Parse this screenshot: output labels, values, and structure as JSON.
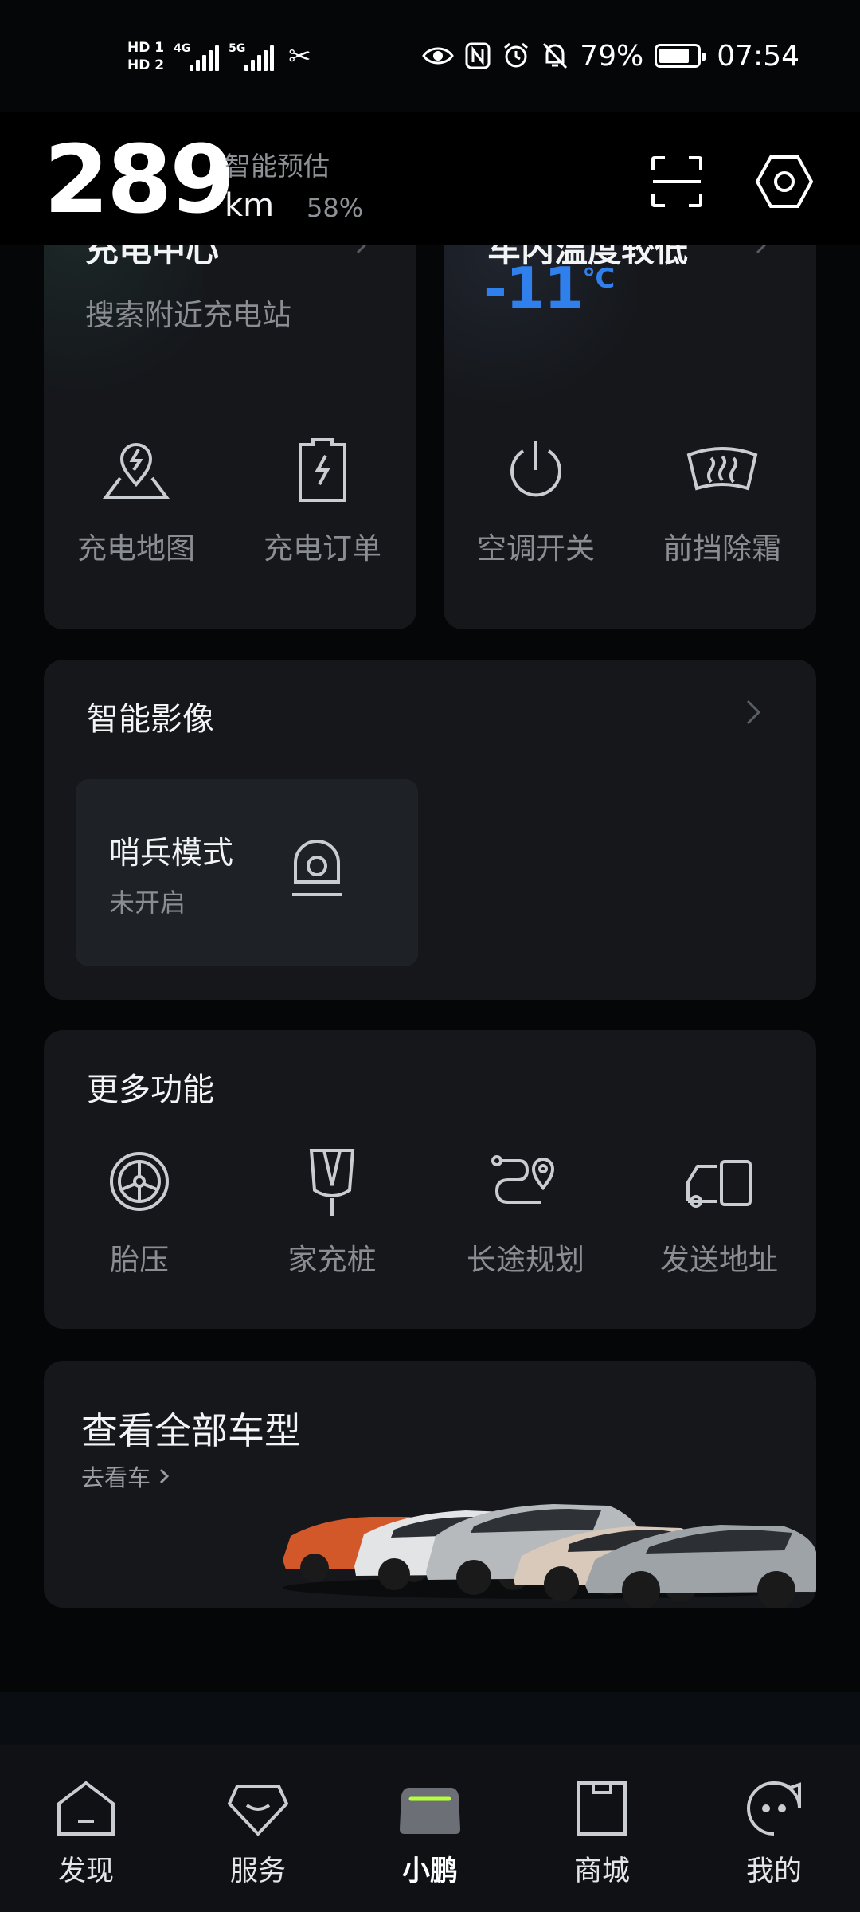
{
  "status_bar": {
    "sim1": "HD 1",
    "sim2": "HD 2",
    "net1": "4G",
    "net2": "5G",
    "battery_pct": "79%",
    "battery_level": 0.79,
    "time": "07:54",
    "icons": [
      "eye-icon",
      "nfc-icon",
      "alarm-icon",
      "mute-icon"
    ]
  },
  "header": {
    "range_value": "289",
    "range_label": "智能预估",
    "range_unit": "km",
    "soc": "58%",
    "icons": [
      "scan-icon",
      "settings-icon"
    ]
  },
  "charging_card": {
    "title": "充电中心",
    "subtitle": "搜索附近充电站",
    "actions": [
      {
        "label": "充电地图",
        "icon": "charging-map-icon"
      },
      {
        "label": "充电订单",
        "icon": "charging-order-icon"
      }
    ]
  },
  "climate_card": {
    "title": "车内温度较低",
    "temperature": "-11",
    "temperature_unit": "℃",
    "actions": [
      {
        "label": "空调开关",
        "icon": "power-icon"
      },
      {
        "label": "前挡除霜",
        "icon": "defrost-icon"
      }
    ]
  },
  "smart_camera": {
    "title": "智能影像",
    "sentry": {
      "title": "哨兵模式",
      "state": "未开启",
      "icon": "sentry-icon"
    }
  },
  "more_functions": {
    "title": "更多功能",
    "items": [
      {
        "label": "胎压",
        "icon": "tire-icon"
      },
      {
        "label": "家充桩",
        "icon": "home-charger-icon"
      },
      {
        "label": "长途规划",
        "icon": "route-icon"
      },
      {
        "label": "发送地址",
        "icon": "send-address-icon"
      }
    ]
  },
  "all_models": {
    "title": "查看全部车型",
    "link": "去看车"
  },
  "tabbar": {
    "items": [
      {
        "label": "发现",
        "icon": "discover-icon",
        "active": false
      },
      {
        "label": "服务",
        "icon": "service-icon",
        "active": false
      },
      {
        "label": "小鹏",
        "icon": "car-icon",
        "active": true
      },
      {
        "label": "商城",
        "icon": "shop-icon",
        "active": false
      },
      {
        "label": "我的",
        "icon": "profile-icon",
        "active": false
      }
    ]
  },
  "colors": {
    "accent_blue": "#2f80ed",
    "active_green": "#b6ff3b",
    "card_bg": "#15171b"
  }
}
